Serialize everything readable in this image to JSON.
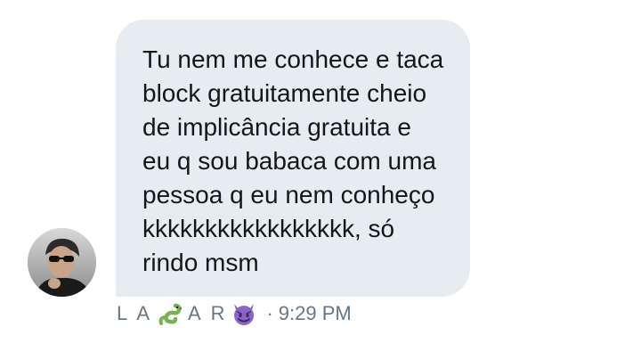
{
  "message": {
    "text": "Tu nem me conhece e taca\nblock gratuitamente cheio\nde implicância gratuita e\neu q sou babaca com uma\npessoa q eu nem conheço\nkkkkkkkkkkkkkkkkk, só\nrindo msm"
  },
  "sender": {
    "name_part1": "L A",
    "name_icon1": "snake-emoji",
    "name_part2": "A R",
    "name_icon2": "smiling-devil-emoji",
    "separator": "·",
    "time": "9:29 PM"
  },
  "colors": {
    "bubble": "#e6ecf0",
    "text": "#14171a",
    "meta": "#657786",
    "snake": "#77b255",
    "devil": "#8a65c7"
  }
}
